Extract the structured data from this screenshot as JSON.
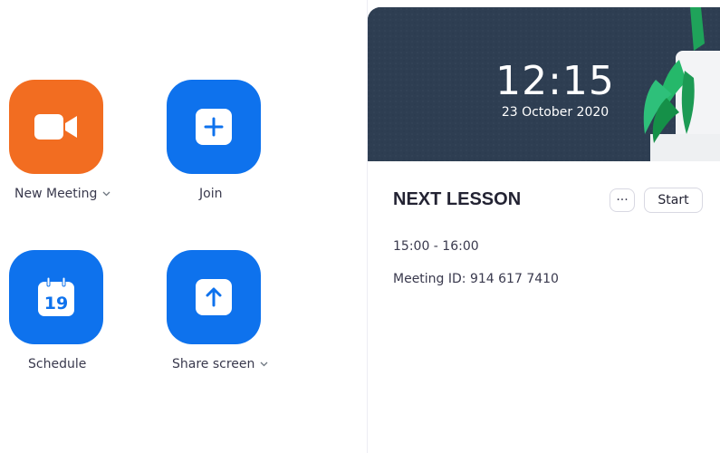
{
  "home": {
    "new_meeting": {
      "label": "New Meeting",
      "has_dropdown": true,
      "icon": "video-camera-icon",
      "color": "#f26d21"
    },
    "join": {
      "label": "Join",
      "icon": "plus-icon",
      "color": "#0e72ed"
    },
    "schedule": {
      "label": "Schedule",
      "icon": "calendar-icon",
      "calendar_day": "19",
      "color": "#0e72ed"
    },
    "share_screen": {
      "label": "Share screen",
      "has_dropdown": true,
      "icon": "upload-arrow-icon",
      "color": "#0e72ed"
    }
  },
  "header": {
    "time": "12:15",
    "date": "23 October 2020"
  },
  "next_lesson": {
    "title": "NEXT LESSON",
    "more_label": "···",
    "start_label": "Start",
    "time_range": "15:00 - 16:00",
    "meeting_id": "Meeting ID: 914 617 7410"
  }
}
